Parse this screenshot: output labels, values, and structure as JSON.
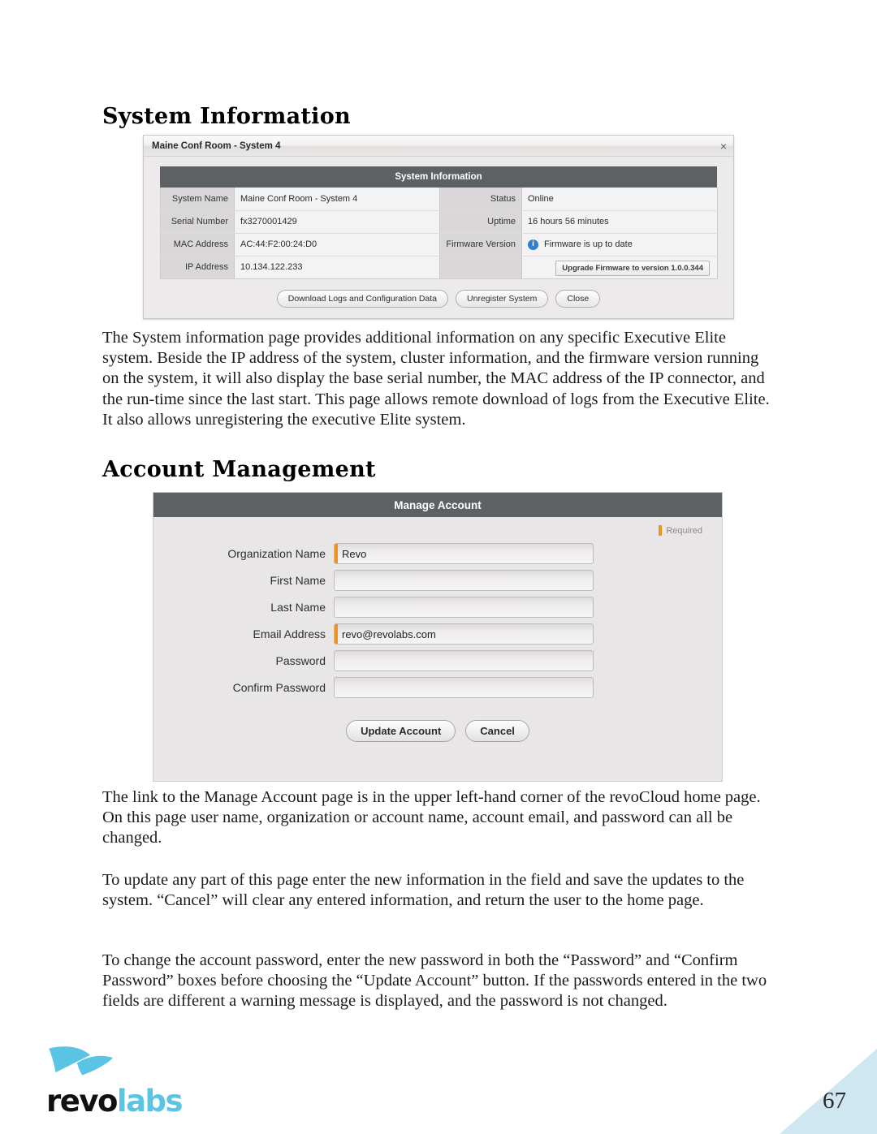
{
  "sections": {
    "system_information": {
      "heading": "System Information",
      "paragraph": "The System information page provides additional information on any specific Executive Elite system.  Beside the IP address of the system, cluster information, and the firmware version running on the system, it will also display the base serial number, the MAC address of the IP connector, and the run-time since the last start.  This page allows remote download of logs from the Executive Elite.  It also allows unregistering the executive Elite system."
    },
    "account_management": {
      "heading": "Account Management",
      "paragraph_link": "The link to the Manage Account page is in the upper left-hand corner of the revoCloud home page.  On this page user name, organization or account name, account email, and password can all be changed.",
      "paragraph_update": "To update any part of this page enter the new information in the field and save the updates to the system.  “Cancel” will clear any entered information, and return the user to the home page.",
      "paragraph_password": "To change the account password, enter the new password in both the “Password” and “Confirm Password” boxes before choosing the “Update Account” button.  If the passwords entered in the two fields are different a warning message is displayed, and the password is not changed."
    }
  },
  "system_info_dialog": {
    "window_title": "Maine Conf Room - System 4",
    "close_icon": "×",
    "banner_title": "System Information",
    "rows": [
      {
        "label_left": "System Name",
        "value_left": "Maine Conf Room - System 4",
        "label_right": "Status",
        "value_right": "Online"
      },
      {
        "label_left": "Serial Number",
        "value_left": "fx3270001429",
        "label_right": "Uptime",
        "value_right": "16 hours 56 minutes"
      },
      {
        "label_left": "MAC Address",
        "value_left": "AC:44:F2:00:24:D0",
        "label_right": "Firmware Version",
        "value_right": "Firmware is up to date"
      },
      {
        "label_left": "IP Address",
        "value_left": "10.134.122.233",
        "label_right": "",
        "value_right": ""
      }
    ],
    "info_icon_glyph": "i",
    "upgrade_button": "Upgrade Firmware to version 1.0.0.344",
    "footer_buttons": [
      "Download Logs and Configuration Data",
      "Unregister System",
      "Close"
    ]
  },
  "manage_account_dialog": {
    "banner_title": "Manage Account",
    "required_label": "Required",
    "required_color": "#f0931e",
    "fields": [
      {
        "label": "Organization Name",
        "value": "Revo",
        "required": true
      },
      {
        "label": "First Name",
        "value": "",
        "required": false
      },
      {
        "label": "Last Name",
        "value": "",
        "required": false
      },
      {
        "label": "Email Address",
        "value": "revo@revolabs.com",
        "required": true
      },
      {
        "label": "Password",
        "value": "",
        "required": false
      },
      {
        "label": "Confirm Password",
        "value": "",
        "required": false
      }
    ],
    "buttons": {
      "update": "Update Account",
      "cancel": "Cancel"
    }
  },
  "footer": {
    "logo_revo": "revo",
    "logo_labs": "labs",
    "page_number": "67",
    "wedge_color": "#cfe7f0"
  }
}
